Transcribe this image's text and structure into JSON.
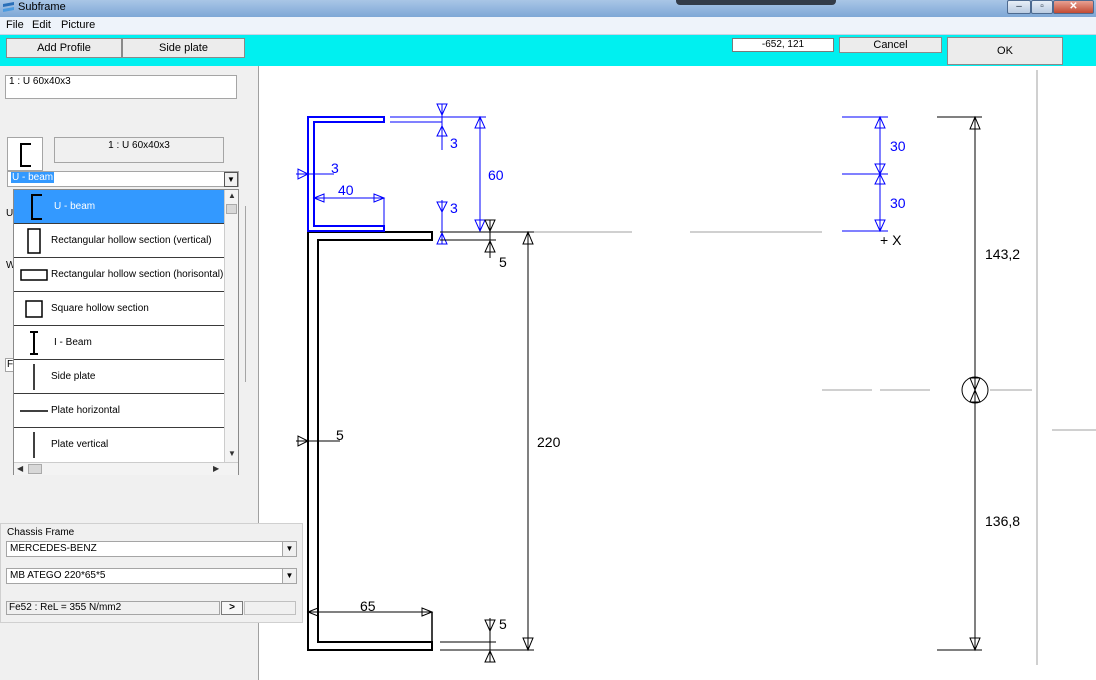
{
  "window": {
    "title": "Subframe",
    "controls": {
      "minimize": "–",
      "maximize": "▫",
      "close": "✕"
    }
  },
  "menu": [
    "File",
    "Edit",
    "Picture"
  ],
  "toolbar": {
    "add_profile": "Add Profile",
    "side_plate": "Side plate",
    "coordinates": "-652, 121",
    "cancel": "Cancel",
    "ok": "OK"
  },
  "left_panel": {
    "profile_list_item": "1 : U 60x40x3",
    "profile_caption": "1 : U 60x40x3",
    "type_select_value": "U - beam",
    "type_options": [
      {
        "label": "U - beam",
        "icon": "u-beam-icon"
      },
      {
        "label": "Rectangular hollow section  (vertical)",
        "icon": "rect-vertical-icon"
      },
      {
        "label": "Rectangular hollow section  (horisontal)",
        "icon": "rect-horizontal-icon"
      },
      {
        "label": "Square hollow section",
        "icon": "square-section-icon"
      },
      {
        "label": "I - Beam",
        "icon": "i-beam-icon"
      },
      {
        "label": "Side plate",
        "icon": "side-plate-icon"
      },
      {
        "label": "Plate horizontal",
        "icon": "plate-horizontal-icon"
      },
      {
        "label": "Plate vertical",
        "icon": "plate-vertical-icon"
      }
    ],
    "hidden_fragments": {
      "u": "U",
      "w": "W",
      "f": "F"
    }
  },
  "chassis": {
    "group_label": "Chassis Frame",
    "make": "MERCEDES-BENZ",
    "model": "MB ATEGO   220*65*5",
    "material": "Fe52 : ReL = 355 N/mm2",
    "expand_button": ">"
  },
  "drawing": {
    "profile_dims": {
      "flange_thickness_top": "3",
      "height": "60",
      "web_thickness": "3",
      "width": "40",
      "flange_thickness_bottom": "3"
    },
    "frame_dims": {
      "flange_top": "5",
      "web": "5",
      "height": "220",
      "width": "65",
      "flange_bottom": "5"
    },
    "spacing": {
      "upper": "30",
      "lower": "30",
      "x_marker": "+ X"
    },
    "neutral_axis": {
      "above": "143,2",
      "below": "136,8"
    },
    "colors": {
      "profile": "#0000ff",
      "frame": "#000000",
      "guide": "#a0a0a0",
      "toolbar": "#00f0f0"
    }
  }
}
